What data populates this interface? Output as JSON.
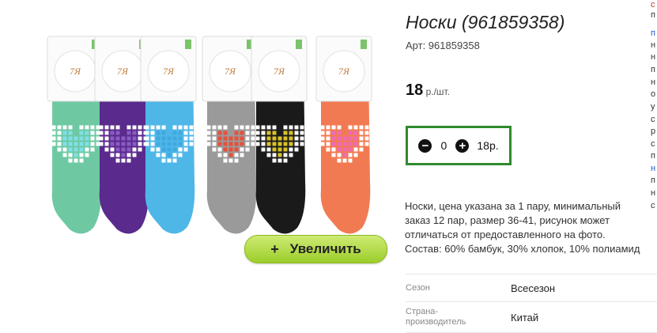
{
  "product": {
    "title": "Носки (961859358)",
    "article": "Арт: 961859358",
    "price_value": "18",
    "price_unit": " р./шт."
  },
  "cart": {
    "quantity": "0",
    "total": "18р."
  },
  "zoom_button": {
    "label": "Увеличить",
    "plus": "+"
  },
  "description_lines": [
    "Носки, цена указана за 1 пару, минимальный",
    "заказ 12 пар, размер 36-41, рисунок может",
    "отличаться от предоставленного на фото.",
    "Состав: 60% бамбук, 30% хлопок, 10% полиамид"
  ],
  "properties": [
    {
      "key": "Сезон",
      "value": "Всесезон"
    },
    {
      "key": "Страна-производитель",
      "key_line1": "Страна-",
      "key_line2": "производитель",
      "value": "Китай"
    }
  ],
  "side_letters": [
    "с",
    "п",
    "п",
    "н",
    "н",
    "п",
    "н",
    "о",
    "у",
    "с",
    "р",
    "с",
    "п",
    "н",
    "п",
    "н",
    "с"
  ],
  "sock_colors": [
    "#6ec9a3",
    "#5a2a8c",
    "#4fb7e8",
    "#9a9a9a",
    "#1a1a1a",
    "#f27a52"
  ],
  "diamond_colors": [
    "#7fe0e8",
    "#8a5cc4",
    "#3fa8e0",
    "#e8503a",
    "#d8c22a",
    "#f06ab8"
  ],
  "tag_logo": "7Я"
}
